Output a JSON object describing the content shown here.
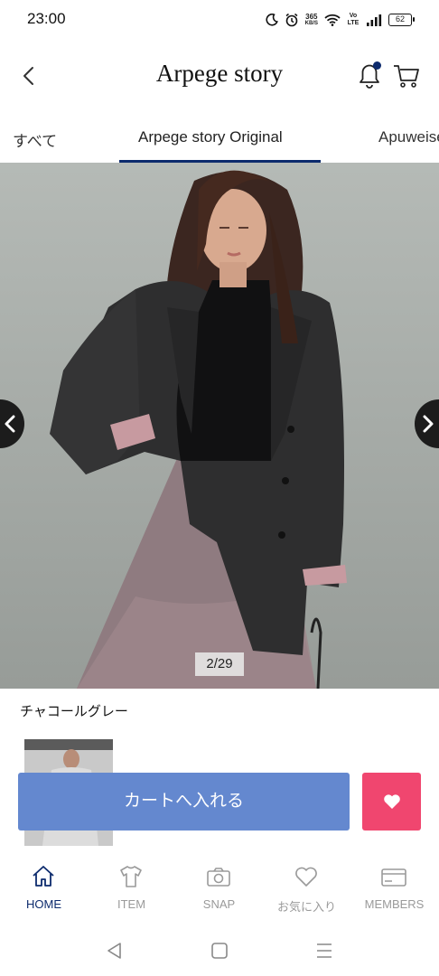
{
  "status_bar": {
    "time": "23:00",
    "network_speed_value": "365",
    "network_speed_unit": "KB/S",
    "volte_label": "Vo LTE",
    "battery_level": "62"
  },
  "header": {
    "title": "Arpege story",
    "notification_badge": true
  },
  "tabs": [
    {
      "label": "すべて",
      "active": false
    },
    {
      "label": "Arpege story Original",
      "active": true
    },
    {
      "label": "Apuweiser",
      "active": false
    }
  ],
  "product": {
    "image_counter": "2/29",
    "current_image": 2,
    "total_images": 29,
    "color_name": "チャコールグレー"
  },
  "actions": {
    "add_to_cart_label": "カートへ入れる",
    "favorite_icon": "heart-icon"
  },
  "bottom_nav": [
    {
      "label": "HOME",
      "icon": "home-icon",
      "active": true
    },
    {
      "label": "ITEM",
      "icon": "tshirt-icon",
      "active": false
    },
    {
      "label": "SNAP",
      "icon": "camera-icon",
      "active": false
    },
    {
      "label": "お気に入り",
      "icon": "heart-outline-icon",
      "active": false
    },
    {
      "label": "MEMBERS",
      "icon": "member-card-icon",
      "active": false
    }
  ],
  "colors": {
    "accent_navy": "#0d2b6d",
    "cart_button": "#6488cf",
    "favorite_button": "#f0466f",
    "nav_inactive": "#9a9a9a"
  }
}
